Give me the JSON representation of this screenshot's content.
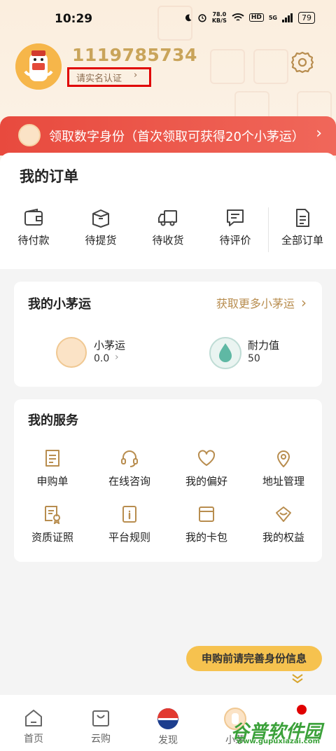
{
  "status_bar": {
    "time": "10:29",
    "net_speed_value": "78.0",
    "net_speed_unit": "KB/S",
    "hd": "HD",
    "signal": "5G",
    "battery": "79"
  },
  "profile": {
    "user_id": "1119785734",
    "verify_label": "请实名认证",
    "verify_arrow": "›"
  },
  "banner": {
    "text": "领取数字身份（首次领取可获得20个小茅运）",
    "arrow": "›"
  },
  "orders": {
    "title": "我的订单",
    "items": [
      {
        "label": "待付款",
        "icon": "wallet-icon"
      },
      {
        "label": "待提货",
        "icon": "box-icon"
      },
      {
        "label": "待收货",
        "icon": "truck-icon"
      },
      {
        "label": "待评价",
        "icon": "comment-icon"
      },
      {
        "label": "全部订单",
        "icon": "document-icon"
      }
    ]
  },
  "xiaomaoyun": {
    "title": "我的小茅运",
    "more": "获取更多小茅运",
    "more_arrow": "›",
    "stats": [
      {
        "name": "小茅运",
        "value": "0.0",
        "arrow": "›",
        "icon": "lucky-coin-icon"
      },
      {
        "name": "耐力值",
        "value": "50",
        "icon": "water-drop-icon"
      }
    ]
  },
  "services": {
    "title": "我的服务",
    "items": [
      {
        "label": "申购单",
        "icon": "form-icon"
      },
      {
        "label": "在线咨询",
        "icon": "headset-icon"
      },
      {
        "label": "我的偏好",
        "icon": "heart-icon"
      },
      {
        "label": "地址管理",
        "icon": "location-pin-icon"
      },
      {
        "label": "资质证照",
        "icon": "certificate-icon"
      },
      {
        "label": "平台规则",
        "icon": "rulebook-icon"
      },
      {
        "label": "我的卡包",
        "icon": "card-wallet-icon"
      },
      {
        "label": "我的权益",
        "icon": "benefit-icon"
      }
    ]
  },
  "cta": {
    "text": "申购前请完善身份信息"
  },
  "tabbar": {
    "items": [
      {
        "label": "首页",
        "icon": "home-icon"
      },
      {
        "label": "云购",
        "icon": "shopping-bag-icon"
      },
      {
        "label": "发现",
        "icon": "discover-logo-icon"
      },
      {
        "label": "小茅",
        "icon": "xiaomao-avatar-icon"
      }
    ]
  },
  "watermark": {
    "name": "谷普软件园",
    "url": "www.gupuxiazai.com"
  },
  "colors": {
    "gold": "#c9a45a",
    "banner_red": "#e84a3e",
    "cta_yellow": "#f6c24f",
    "icon_gold": "#b88d4f"
  }
}
